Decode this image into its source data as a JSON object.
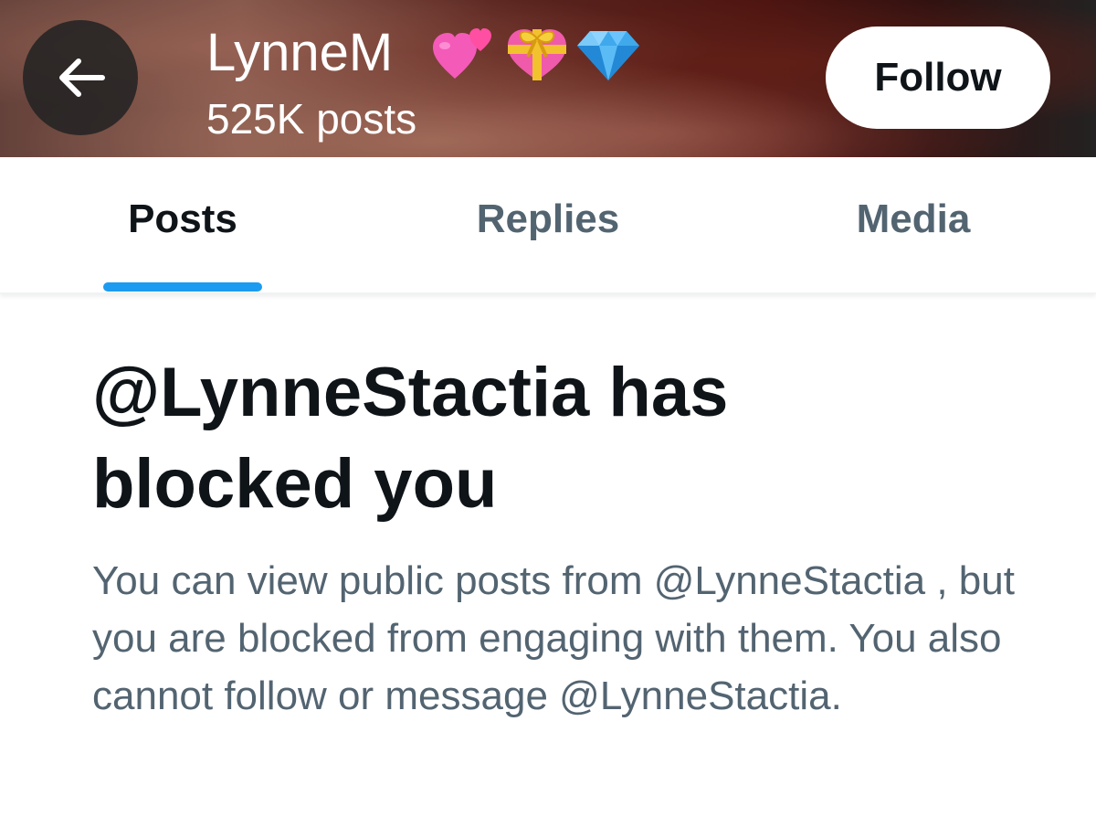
{
  "header": {
    "back_icon": "arrow-left-icon",
    "name": "LynneM",
    "name_emoji": [
      "💕",
      "💝",
      "💎"
    ],
    "post_count": "525K posts",
    "follow_label": "Follow"
  },
  "tabs": [
    {
      "label": "Posts",
      "active": true
    },
    {
      "label": "Replies",
      "active": false
    },
    {
      "label": "Media",
      "active": false
    }
  ],
  "colors": {
    "accent": "#1d9bf0",
    "primary_text": "#0f1419",
    "secondary_text": "#536471"
  },
  "blocked": {
    "title": "@LynneStactia has blocked you",
    "description": "You can view public posts from @LynneStactia , but you are blocked from engaging with them. You also cannot follow or message @LynneStactia."
  }
}
